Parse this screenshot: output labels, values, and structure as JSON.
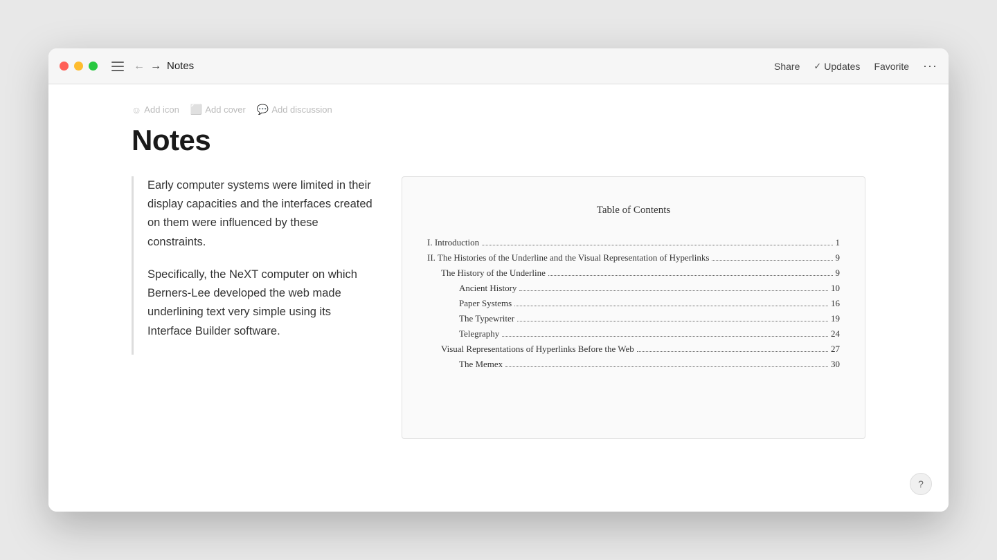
{
  "window": {
    "title": "Notes"
  },
  "titlebar": {
    "traffic_lights": [
      "red",
      "yellow",
      "green"
    ],
    "back_arrow": "←",
    "forward_arrow": "→",
    "page_title": "Notes",
    "actions": {
      "share": "Share",
      "updates": "Updates",
      "favorite": "Favorite",
      "more": "···"
    }
  },
  "page": {
    "meta_actions": [
      {
        "icon": "☺",
        "label": "Add icon"
      },
      {
        "icon": "🖼",
        "label": "Add cover"
      },
      {
        "icon": "💬",
        "label": "Add discussion"
      }
    ],
    "heading": "Notes",
    "blockquote": {
      "paragraph1": "Early computer systems were limited in their display capacities and the interfaces created on them were influenced by these constraints.",
      "paragraph2": "Specifically, the NeXT computer on which Berners-Lee developed the web made underlining text very simple using its Interface Builder software."
    },
    "toc": {
      "title": "Table of Contents",
      "entries": [
        {
          "text": "I. Introduction",
          "page": "1",
          "indent": 0
        },
        {
          "text": "II. The Histories of the Underline and the Visual Representation of Hyperlinks",
          "page": "9",
          "indent": 0
        },
        {
          "text": "The History of the Underline",
          "page": "9",
          "indent": 1
        },
        {
          "text": "Ancient History",
          "page": "10",
          "indent": 2
        },
        {
          "text": "Paper Systems",
          "page": "16",
          "indent": 2
        },
        {
          "text": "The Typewriter",
          "page": "19",
          "indent": 2
        },
        {
          "text": "Telegraphy",
          "page": "24",
          "indent": 2
        },
        {
          "text": "Visual Representations of Hyperlinks Before the Web",
          "page": "27",
          "indent": 1
        },
        {
          "text": "The Memex",
          "page": "30",
          "indent": 2
        }
      ]
    }
  },
  "help": {
    "label": "?"
  }
}
